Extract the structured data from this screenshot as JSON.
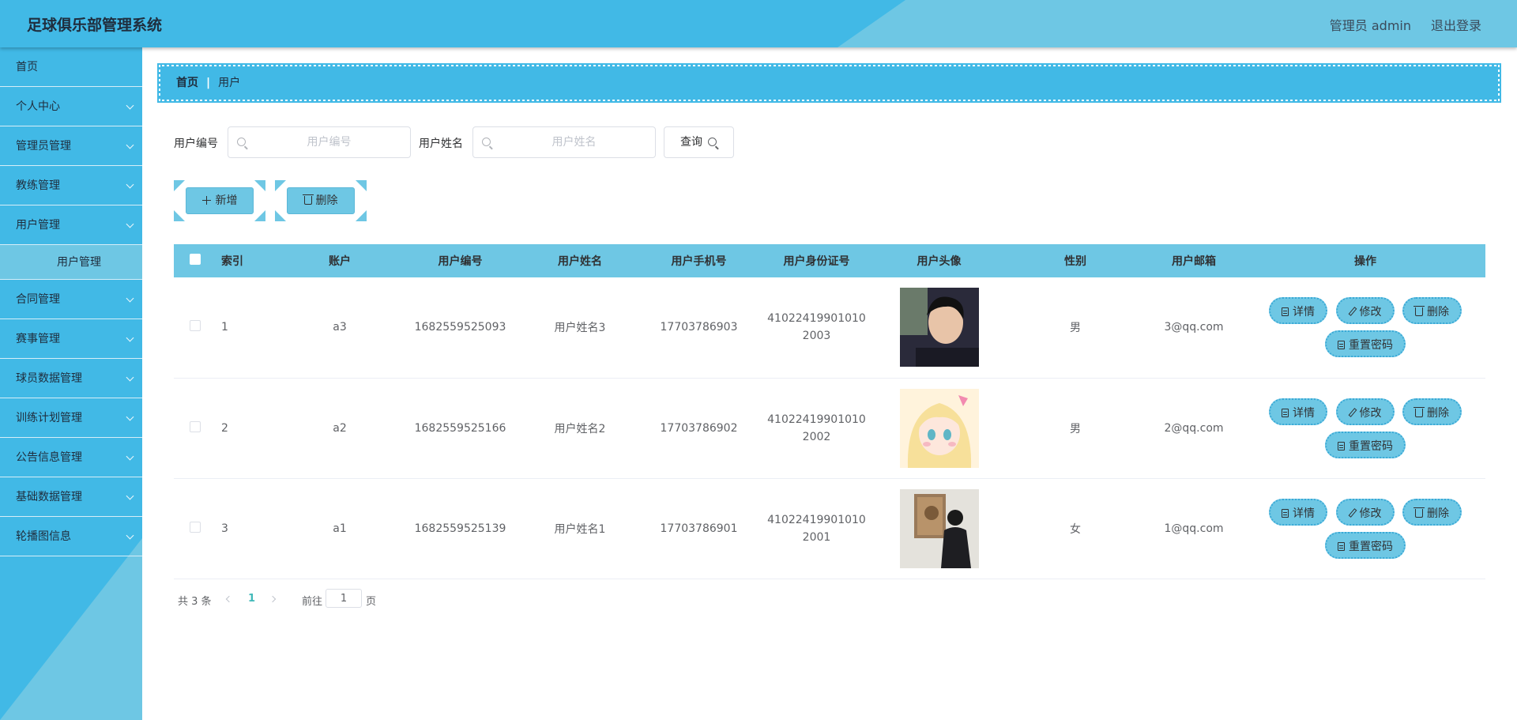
{
  "header": {
    "title": "足球俱乐部管理系统",
    "admin_label": "管理员 admin",
    "logout": "退出登录"
  },
  "sidebar": {
    "items": [
      {
        "label": "首页"
      },
      {
        "label": "个人中心"
      },
      {
        "label": "管理员管理"
      },
      {
        "label": "教练管理"
      },
      {
        "label": "用户管理"
      },
      {
        "label": "合同管理"
      },
      {
        "label": "赛事管理"
      },
      {
        "label": "球员数据管理"
      },
      {
        "label": "训练计划管理"
      },
      {
        "label": "公告信息管理"
      },
      {
        "label": "基础数据管理"
      },
      {
        "label": "轮播图信息"
      }
    ],
    "sub_item": "用户管理"
  },
  "breadcrumb": {
    "home": "首页",
    "separator": "|",
    "current": "用户"
  },
  "search": {
    "code_label": "用户编号",
    "code_placeholder": "用户编号",
    "name_label": "用户姓名",
    "name_placeholder": "用户姓名",
    "query_btn": "查询"
  },
  "actions": {
    "add": "新增",
    "delete": "删除"
  },
  "table": {
    "headers": [
      "索引",
      "账户",
      "用户编号",
      "用户姓名",
      "用户手机号",
      "用户身份证号",
      "用户头像",
      "性别",
      "用户邮箱",
      "操作"
    ],
    "rows": [
      {
        "index": "1",
        "account": "a3",
        "code": "1682559525093",
        "name": "用户姓名3",
        "phone": "17703786903",
        "id_card": "410224199010102003",
        "gender": "男",
        "email": "3@qq.com",
        "avatar": "portrait-man"
      },
      {
        "index": "2",
        "account": "a2",
        "code": "1682559525166",
        "name": "用户姓名2",
        "phone": "17703786902",
        "id_card": "410224199010102002",
        "gender": "男",
        "email": "2@qq.com",
        "avatar": "anime-girl"
      },
      {
        "index": "3",
        "account": "a1",
        "code": "1682559525139",
        "name": "用户姓名1",
        "phone": "17703786901",
        "id_card": "410224199010102001",
        "gender": "女",
        "email": "1@qq.com",
        "avatar": "person-at-painting"
      }
    ],
    "ops": {
      "detail": "详情",
      "edit": "修改",
      "delete": "删除",
      "reset": "重置密码"
    }
  },
  "pagination": {
    "total": "共 3 条",
    "current_page": "1",
    "goto_label": "前往",
    "goto_value": "1",
    "page_suffix": "页"
  },
  "colors": {
    "primary": "#41b9e6",
    "light": "#6ec7e4",
    "active_page": "#41b9b9"
  }
}
